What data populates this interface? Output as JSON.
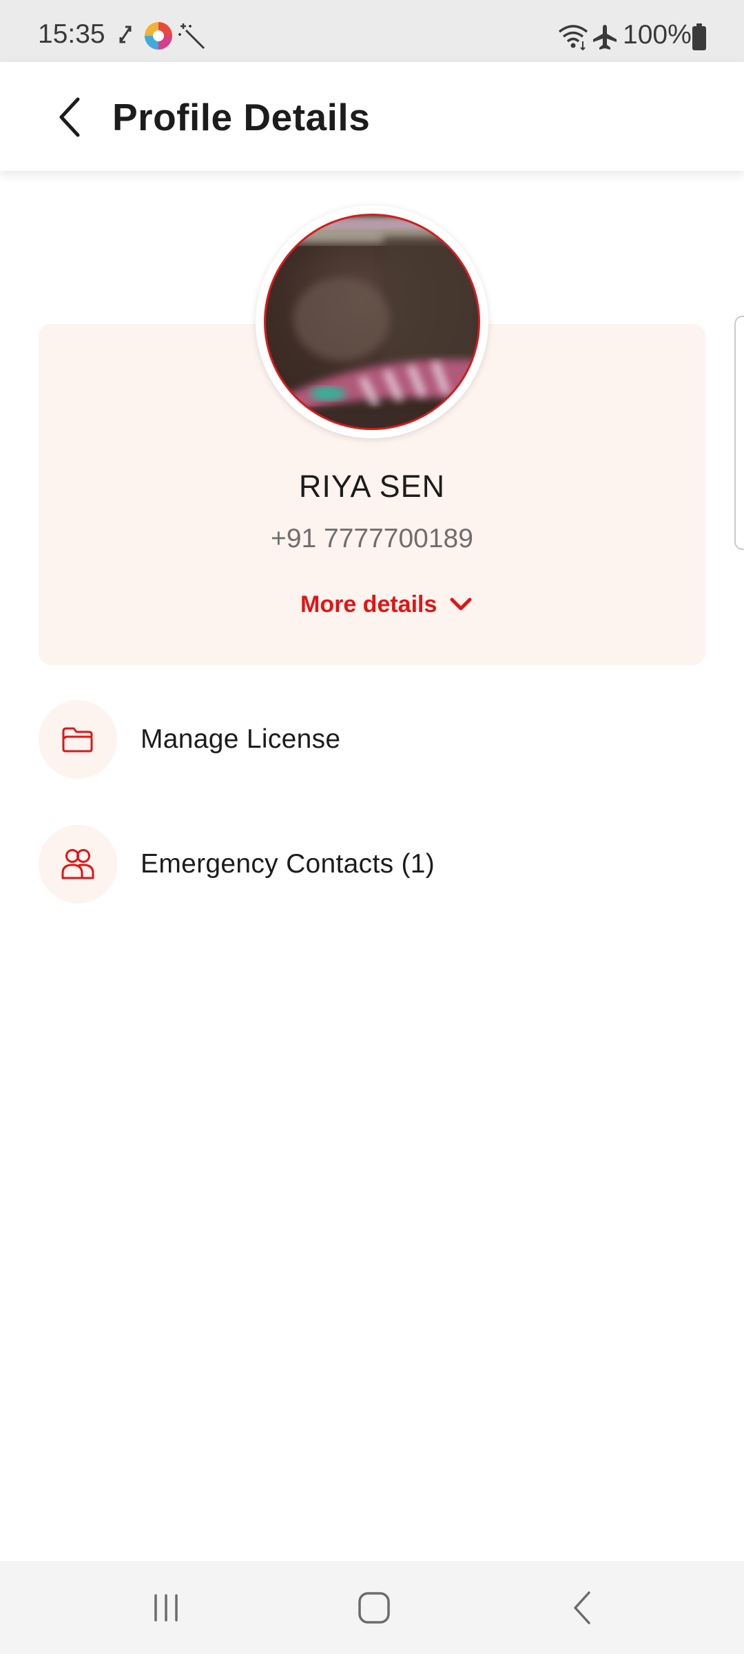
{
  "status_bar": {
    "time": "15:35",
    "battery": "100%",
    "icons": [
      "sync-icon",
      "app-notification-icon",
      "magic-wand-icon",
      "wifi-icon",
      "airplane-mode-icon",
      "battery-icon"
    ]
  },
  "app_bar": {
    "title": "Profile Details",
    "back_icon": "chevron-left-icon"
  },
  "profile": {
    "name": "RIYA SEN",
    "phone": "+91 7777700189",
    "more_details_label": "More details",
    "more_details_icon": "chevron-down-icon"
  },
  "menu": {
    "items": [
      {
        "label": "Manage License",
        "icon": "folder-icon"
      },
      {
        "label": "Emergency Contacts (1)",
        "icon": "contacts-icon"
      }
    ]
  },
  "nav_bar": {
    "buttons": [
      "recent-apps-icon",
      "home-icon",
      "back-icon"
    ]
  },
  "colors": {
    "accent": "#e01515",
    "card_background": "#fdf3ef",
    "status_bar_background": "#ebebeb",
    "nav_bar_background": "#f4f4f4"
  }
}
